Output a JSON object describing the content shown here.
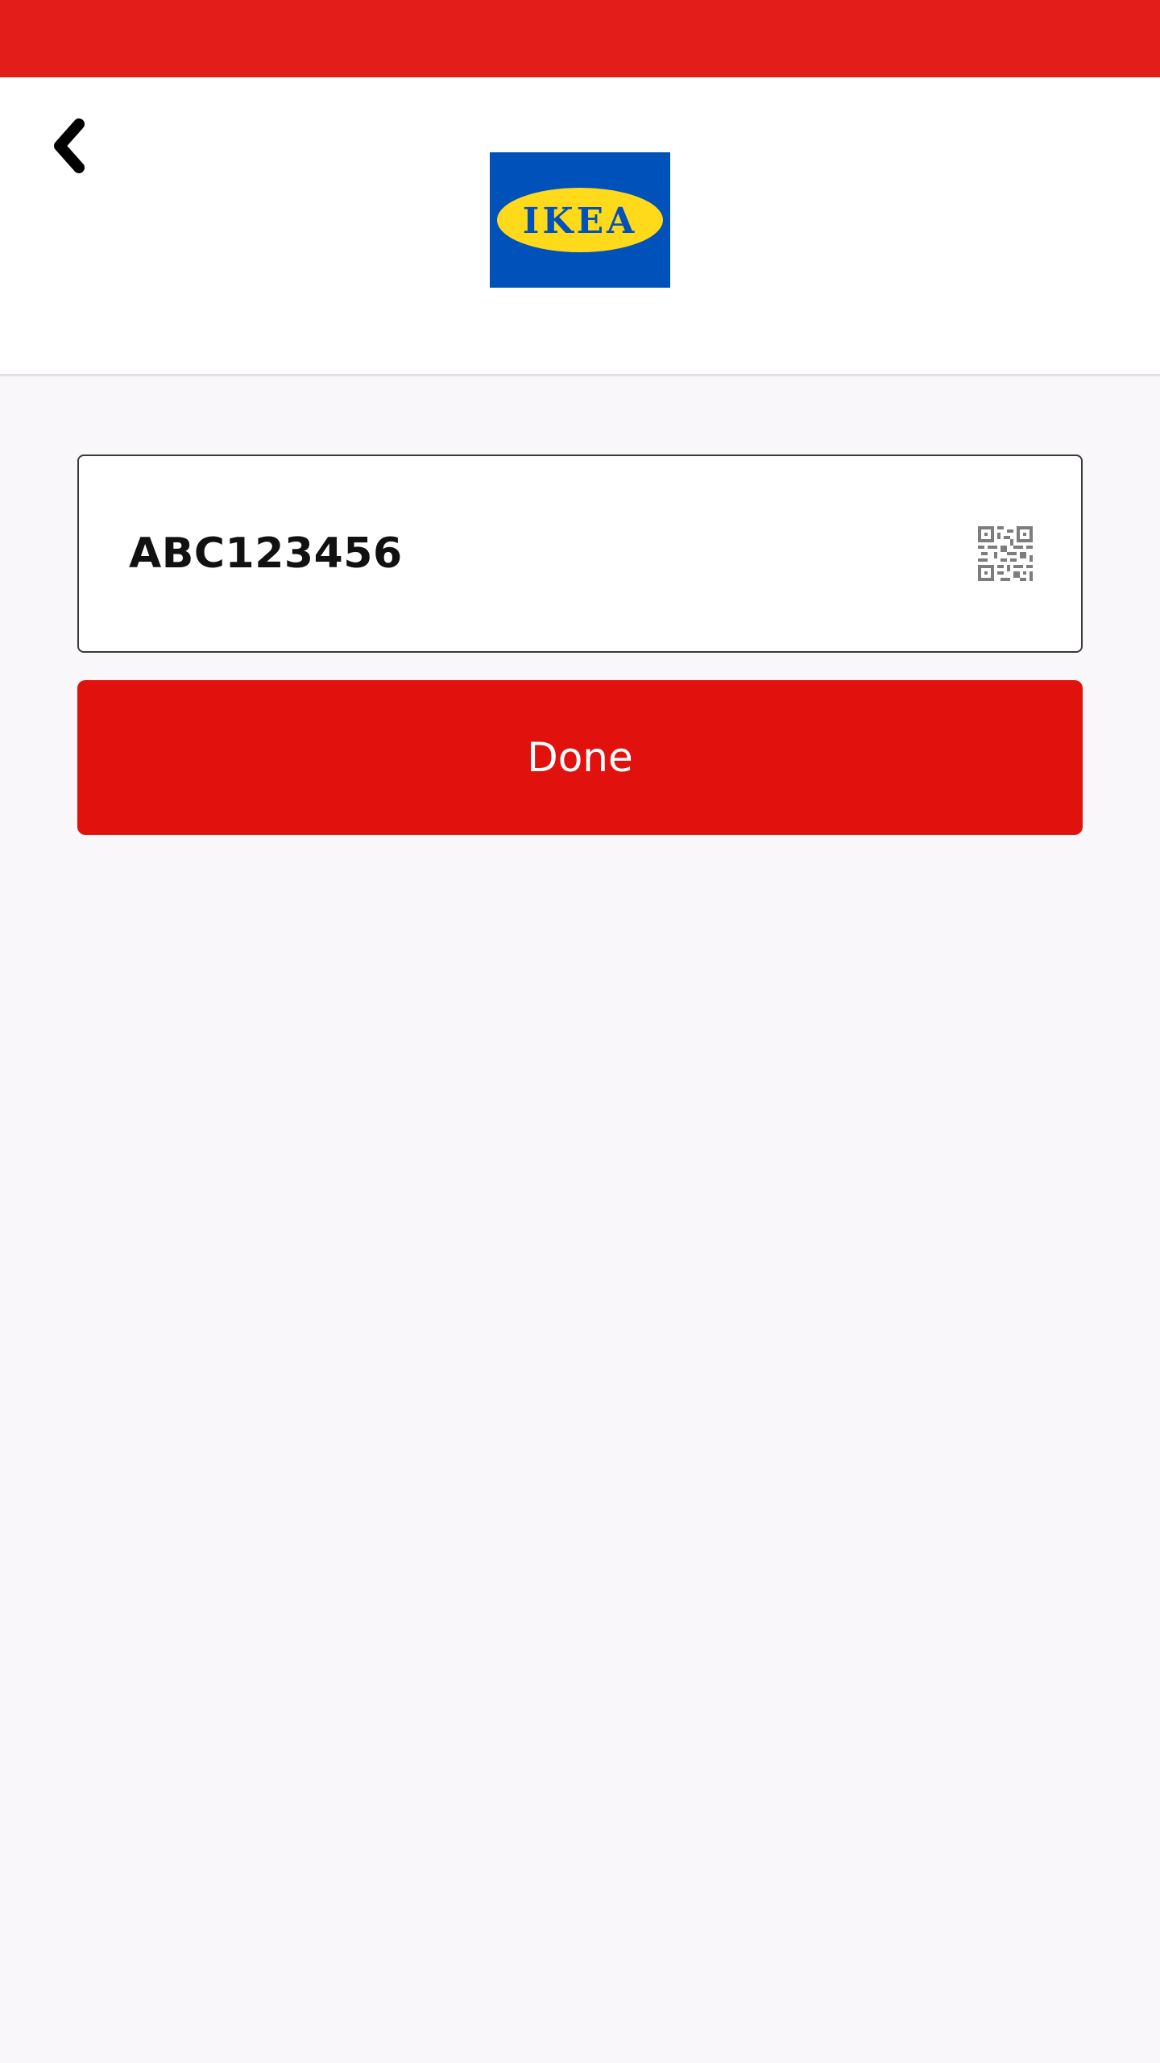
{
  "header": {
    "logo_text": "IKEA"
  },
  "form": {
    "code_value": "ABC123456",
    "done_label": "Done"
  },
  "icons": {
    "back": "chevron-left-icon",
    "scan": "qr-code-icon"
  },
  "colors": {
    "status_bar": "#e31e1a",
    "primary_button": "#e1120e",
    "logo_blue": "#0051ba",
    "logo_yellow": "#ffda1a",
    "background": "#f9f7fa"
  }
}
